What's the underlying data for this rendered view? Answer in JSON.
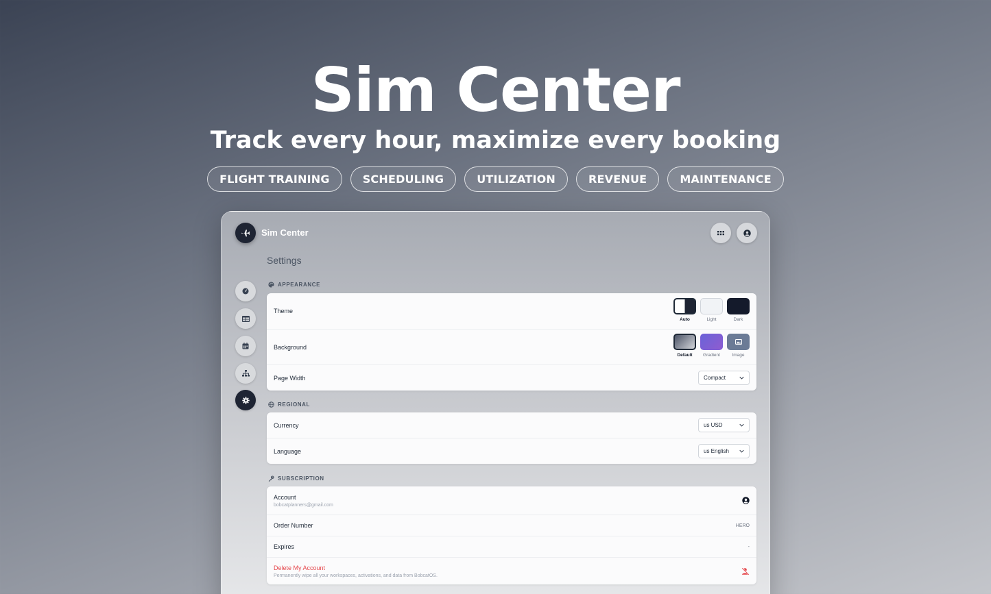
{
  "hero": {
    "title": "Sim Center",
    "subtitle": "Track every hour, maximize every booking",
    "tags": [
      "FLIGHT TRAINING",
      "SCHEDULING",
      "UTILIZATION",
      "REVENUE",
      "MAINTENANCE"
    ]
  },
  "app": {
    "name": "Sim Center",
    "page_title": "Settings",
    "sidebar_icons": [
      "dashboard-icon",
      "table-icon",
      "calendar-icon",
      "sitemap-icon",
      "gear-icon"
    ]
  },
  "appearance": {
    "label": "APPEARANCE",
    "theme_label": "Theme",
    "themes": [
      "Auto",
      "Light",
      "Dark"
    ],
    "background_label": "Background",
    "backgrounds": [
      "Default",
      "Gradient",
      "Image"
    ],
    "page_width_label": "Page Width",
    "page_width_value": "Compact"
  },
  "regional": {
    "label": "REGIONAL",
    "currency_label": "Currency",
    "currency_value": "us USD",
    "language_label": "Language",
    "language_value": "us English"
  },
  "subscription": {
    "label": "SUBSCRIPTION",
    "account_label": "Account",
    "account_email": "bobcatplanners@gmail.com",
    "order_label": "Order Number",
    "order_value": "HERO",
    "expires_label": "Expires",
    "expires_value": "-",
    "delete_label": "Delete My Account",
    "delete_desc": "Permanently wipe all your workspaces, activations, and data from BobcatOS."
  },
  "colors": {
    "accent_dark": "#1e2433",
    "danger": "#e5484d",
    "gradient_swatch": "#7b5cd6"
  }
}
